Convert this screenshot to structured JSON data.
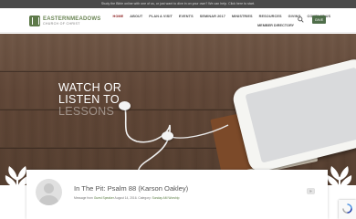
{
  "topbar": {
    "announcement": "Study the Bible online with one of us, or just want to dive in on your own? We can help. Click here to start."
  },
  "header": {
    "logo": {
      "line1": "EASTERNMEADOWS",
      "line2": "CHURCH OF CHRIST"
    },
    "nav": [
      {
        "label": "HOME",
        "active": true
      },
      {
        "label": "ABOUT",
        "active": false
      },
      {
        "label": "PLAN A VISIT",
        "active": false
      },
      {
        "label": "EVENTS",
        "active": false
      },
      {
        "label": "SEMINAR 2017",
        "active": false
      },
      {
        "label": "MINISTRIES",
        "active": false
      },
      {
        "label": "RESOURCES",
        "active": false
      },
      {
        "label": "GIVING",
        "active": false
      },
      {
        "label": "CONTACT US",
        "active": false
      }
    ],
    "nav_second_row": "MEMBER DIRECTORY",
    "give_label": "GIVE",
    "search_icon": "search-icon"
  },
  "hero": {
    "line1": "WATCH OR",
    "line2": "LISTEN TO",
    "line3": "LESSONS"
  },
  "sermon": {
    "title": "In The Pit: Psalm 88 (Karson Oakley)",
    "meta_prefix": "Message from",
    "speaker": "Guest Speaker",
    "meta_date": "August 14, 2016.",
    "category_label": "Category:",
    "category": "Sunday AM Worship",
    "media_icon": "video-icon"
  },
  "colors": {
    "accent_green": "#4f6e4a",
    "active_nav": "#8b1e1e",
    "topbar_bg": "#4a4a4a"
  }
}
